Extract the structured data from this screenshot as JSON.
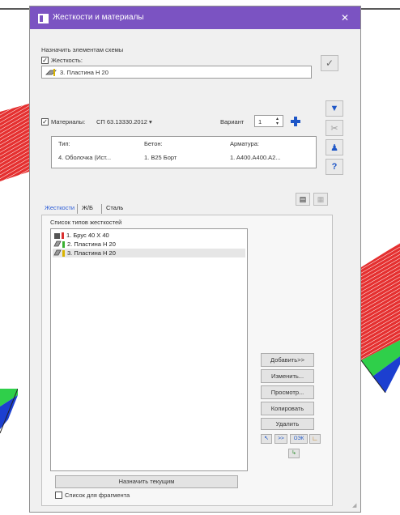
{
  "window": {
    "title": "Жесткости и материалы",
    "close": "✕"
  },
  "assign_group": {
    "caption": "Назначить элементам схемы",
    "stiffness_check": "✓",
    "stiffness_label": "Жесткость:",
    "stiffness_value": "3. Пластина  H 20",
    "material_check": "✓",
    "material_label": "Материалы:",
    "material_norm": "СП 63.13330.2012",
    "variant_label": "Вариант",
    "variant_value": "1",
    "mat_headers": {
      "type": "Тип:",
      "concrete": "Бетон:",
      "rebar": "Арматура:"
    },
    "mat_values": {
      "type": "4. Оболочка (Ист...",
      "concrete": "1. B25 Борт",
      "rebar": "1. A400.A400.A2..."
    }
  },
  "tabs": [
    "Жесткости",
    "Ж/Б",
    "Сталь"
  ],
  "list_caption": "Список типов жесткостей",
  "list_items": [
    {
      "label": "1. Брус 40 X 40"
    },
    {
      "label": "2. Пластина  H 20"
    },
    {
      "label": "3. Пластина  H 20"
    }
  ],
  "buttons": {
    "add": "Добавить>>",
    "edit": "Изменить...",
    "view": "Просмотр...",
    "copy": "Копировать",
    "delete": "Удалить",
    "assign_current": "Назначить текущим"
  },
  "small_btns": {
    "b1": ">>",
    "b2": "ОЭК"
  },
  "fragment_label": "Список для фрагмента",
  "colors": {
    "titlebar": "#7b53c2",
    "tab_active": "#2a5bd7",
    "accent_blue": "#1e56c7"
  }
}
